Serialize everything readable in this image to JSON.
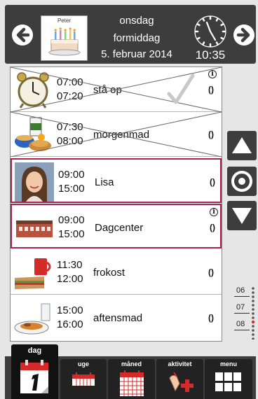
{
  "header": {
    "profile_name": "Peter",
    "weekday": "onsdag",
    "daypart": "formiddag",
    "date": "5. februar 2014",
    "time": "10:35"
  },
  "activities": [
    {
      "start": "07:00",
      "end": "07:20",
      "title": "stå op",
      "icon": "alarm-clock-icon",
      "done": true,
      "info": true,
      "repeat": true
    },
    {
      "start": "07:30",
      "end": "08:00",
      "title": "morgenmad",
      "icon": "breakfast-icon",
      "done": true,
      "info": false,
      "repeat": true
    },
    {
      "start": "09:00",
      "end": "15:00",
      "title": "Lisa",
      "icon": "person-photo",
      "done": false,
      "info": false,
      "repeat": true,
      "selected": true
    },
    {
      "start": "09:00",
      "end": "15:00",
      "title": "Dagcenter",
      "icon": "building-icon",
      "done": false,
      "info": true,
      "repeat": true,
      "selected": true
    },
    {
      "start": "11:30",
      "end": "12:00",
      "title": "frokost",
      "icon": "lunch-icon",
      "done": false,
      "info": false,
      "repeat": true
    },
    {
      "start": "15:00",
      "end": "16:00",
      "title": "aftensmad",
      "icon": "dinner-icon",
      "done": false,
      "info": false,
      "repeat": true
    }
  ],
  "symbols": {
    "info": "i",
    "repeat": "()"
  },
  "timeline": {
    "labels": [
      "06",
      "07",
      "08"
    ],
    "current_marker": "08"
  },
  "tabs": [
    {
      "id": "day",
      "label": "dag",
      "active": true
    },
    {
      "id": "week",
      "label": "uge",
      "active": false
    },
    {
      "id": "month",
      "label": "måned",
      "active": false
    },
    {
      "id": "activity",
      "label": "aktivitet",
      "active": false
    },
    {
      "id": "menu",
      "label": "menu",
      "active": false
    }
  ],
  "colors": {
    "header_bg": "#3d3d3d",
    "selected_border": "#a8244f",
    "tab_bg": "#222222"
  }
}
